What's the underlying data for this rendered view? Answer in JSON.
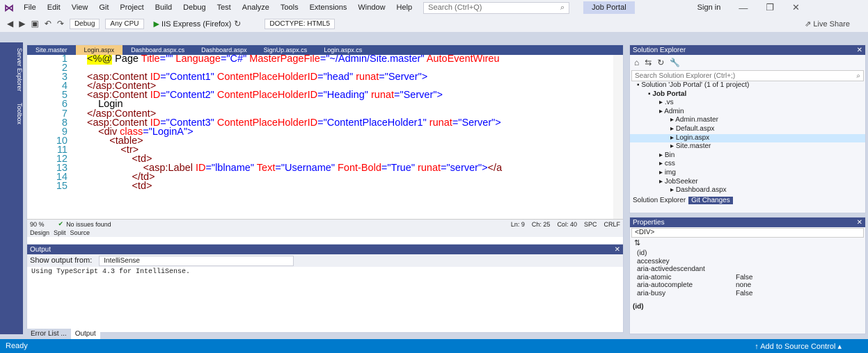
{
  "menu": {
    "items": [
      "File",
      "Edit",
      "View",
      "Git",
      "Project",
      "Build",
      "Debug",
      "Test",
      "Analyze",
      "Tools",
      "Extensions",
      "Window",
      "Help"
    ],
    "search_placeholder": "Search (Ctrl+Q)",
    "solution_title": "Job Portal",
    "sign_in": "Sign in"
  },
  "toolbar": {
    "config": "Debug",
    "platform": "Any CPU",
    "run": "IIS Express (Firefox)",
    "doctype": "DOCTYPE: HTML5",
    "live_share": "Live Share"
  },
  "side": {
    "server_explorer": "Server Explorer",
    "toolbox": "Toolbox"
  },
  "editor": {
    "tabs": [
      {
        "label": "Site.master"
      },
      {
        "label": "Login.aspx"
      },
      {
        "label": "Dashboard.aspx.cs"
      },
      {
        "label": "Dashboard.aspx"
      },
      {
        "label": "SignUp.aspx.cs"
      },
      {
        "label": "Login.aspx.cs"
      }
    ],
    "lines": [
      {
        "n": "1",
        "parts": [
          {
            "c": "dir",
            "t": "<%@"
          },
          {
            "c": "txt",
            "t": " Page "
          },
          {
            "c": "attr",
            "t": "Title"
          },
          {
            "c": "val",
            "t": "=\"\" "
          },
          {
            "c": "attr",
            "t": "Language"
          },
          {
            "c": "val",
            "t": "=\"C#\" "
          },
          {
            "c": "attr",
            "t": "MasterPageFile"
          },
          {
            "c": "val",
            "t": "=\"~/Admin/Site.master\" "
          },
          {
            "c": "attr",
            "t": "AutoEventWireu"
          }
        ]
      },
      {
        "n": "2",
        "parts": []
      },
      {
        "n": "3",
        "parts": [
          {
            "c": "tag",
            "t": "<asp:Content "
          },
          {
            "c": "attr",
            "t": "ID"
          },
          {
            "c": "val",
            "t": "=\"Content1\" "
          },
          {
            "c": "attr",
            "t": "ContentPlaceHolderID"
          },
          {
            "c": "val",
            "t": "=\"head\" "
          },
          {
            "c": "attr",
            "t": "runat"
          },
          {
            "c": "val",
            "t": "=\"Server\">"
          }
        ]
      },
      {
        "n": "4",
        "parts": [
          {
            "c": "tag",
            "t": "</asp:Content>"
          }
        ]
      },
      {
        "n": "5",
        "parts": [
          {
            "c": "tag",
            "t": "<asp:Content "
          },
          {
            "c": "attr",
            "t": "ID"
          },
          {
            "c": "val",
            "t": "=\"Content2\" "
          },
          {
            "c": "attr",
            "t": "ContentPlaceHolderID"
          },
          {
            "c": "val",
            "t": "=\"Heading\" "
          },
          {
            "c": "attr",
            "t": "runat"
          },
          {
            "c": "val",
            "t": "=\"Server\">"
          }
        ]
      },
      {
        "n": "6",
        "parts": [
          {
            "c": "txt",
            "t": "    Login"
          }
        ]
      },
      {
        "n": "7",
        "parts": [
          {
            "c": "tag",
            "t": "</asp:Content>"
          }
        ]
      },
      {
        "n": "8",
        "parts": [
          {
            "c": "tag",
            "t": "<asp:Content "
          },
          {
            "c": "attr",
            "t": "ID"
          },
          {
            "c": "val",
            "t": "=\"Content3\" "
          },
          {
            "c": "attr",
            "t": "ContentPlaceHolderID"
          },
          {
            "c": "val",
            "t": "=\"ContentPlaceHolder1\" "
          },
          {
            "c": "attr",
            "t": "runat"
          },
          {
            "c": "val",
            "t": "=\"Server\">"
          }
        ]
      },
      {
        "n": "9",
        "parts": [
          {
            "c": "tag",
            "t": "    <div "
          },
          {
            "c": "attr",
            "t": "class"
          },
          {
            "c": "val",
            "t": "=\"LoginA\">"
          }
        ]
      },
      {
        "n": "10",
        "parts": [
          {
            "c": "tag",
            "t": "        <table>"
          }
        ]
      },
      {
        "n": "11",
        "parts": [
          {
            "c": "tag",
            "t": "            <tr>"
          }
        ]
      },
      {
        "n": "12",
        "parts": [
          {
            "c": "tag",
            "t": "                <td>"
          }
        ]
      },
      {
        "n": "13",
        "parts": [
          {
            "c": "tag",
            "t": "                    <asp:Label "
          },
          {
            "c": "attr",
            "t": "ID"
          },
          {
            "c": "val",
            "t": "=\"lblname\" "
          },
          {
            "c": "attr",
            "t": "Text"
          },
          {
            "c": "val",
            "t": "=\"Username\" "
          },
          {
            "c": "attr",
            "t": "Font-Bold"
          },
          {
            "c": "val",
            "t": "=\"True\" "
          },
          {
            "c": "attr",
            "t": "runat"
          },
          {
            "c": "val",
            "t": "=\"server\">"
          },
          {
            "c": "tag",
            "t": "</a"
          }
        ]
      },
      {
        "n": "14",
        "parts": [
          {
            "c": "tag",
            "t": "                </td>"
          }
        ]
      },
      {
        "n": "15",
        "parts": [
          {
            "c": "tag",
            "t": "                <td>"
          }
        ]
      }
    ],
    "status": {
      "zoom": "90 %",
      "issues": "No issues found",
      "ln": "Ln: 9",
      "ch": "Ch: 25",
      "col": "Col: 40",
      "spc": "SPC",
      "crlf": "CRLF"
    },
    "views": {
      "design": "Design",
      "split": "Split",
      "source": "Source"
    }
  },
  "output": {
    "title": "Output",
    "show_from_label": "Show output from:",
    "show_from_value": "IntelliSense",
    "text": "Using TypeScript 4.3 for IntelliSense.",
    "tabs": [
      "Error List ...",
      "Output"
    ]
  },
  "solution": {
    "title": "Solution Explorer",
    "search_placeholder": "Search Solution Explorer (Ctrl+;)",
    "tree": [
      {
        "d": 0,
        "t": "Solution 'Job Portal' (1 of 1 project)"
      },
      {
        "d": 1,
        "t": "Job Portal",
        "b": true
      },
      {
        "d": 2,
        "t": ".vs"
      },
      {
        "d": 2,
        "t": "Admin"
      },
      {
        "d": 3,
        "t": "Admin.master"
      },
      {
        "d": 3,
        "t": "Default.aspx"
      },
      {
        "d": 3,
        "t": "Login.aspx",
        "sel": true
      },
      {
        "d": 3,
        "t": "Site.master"
      },
      {
        "d": 2,
        "t": "Bin"
      },
      {
        "d": 2,
        "t": "css"
      },
      {
        "d": 2,
        "t": "img"
      },
      {
        "d": 2,
        "t": "JobSeeker"
      },
      {
        "d": 3,
        "t": "Dashboard.aspx"
      }
    ],
    "tabs": [
      "Solution Explorer",
      "Git Changes"
    ]
  },
  "properties": {
    "title": "Properties",
    "selected": "<DIV>",
    "rows": [
      {
        "n": "(id)",
        "v": ""
      },
      {
        "n": "accesskey",
        "v": ""
      },
      {
        "n": "aria-activedescendant",
        "v": ""
      },
      {
        "n": "aria-atomic",
        "v": "False"
      },
      {
        "n": "aria-autocomplete",
        "v": "none"
      },
      {
        "n": "aria-busy",
        "v": "False"
      }
    ],
    "desc": "(id)"
  },
  "statusbar": {
    "ready": "Ready",
    "source_control": "Add to Source Control"
  }
}
